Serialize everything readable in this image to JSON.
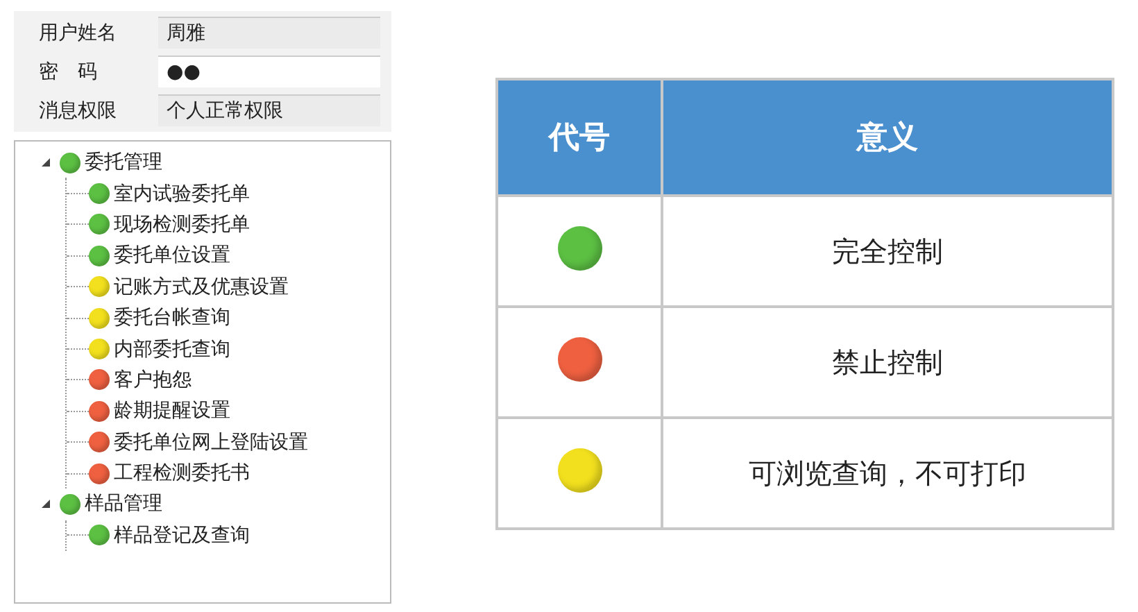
{
  "login_fields": [
    {
      "label": "用户姓名",
      "value": "周雅",
      "readonly": true
    },
    {
      "label": "密　码",
      "value": "●●",
      "readonly": false
    },
    {
      "label": "消息权限",
      "value": "个人正常权限",
      "readonly": true
    }
  ],
  "tree": [
    {
      "label": "委托管理",
      "color": "#5cc043",
      "expanded": true,
      "children": [
        {
          "label": "室内试验委托单",
          "color": "#5cc043"
        },
        {
          "label": "现场检测委托单",
          "color": "#5cc043"
        },
        {
          "label": "委托单位设置",
          "color": "#5cc043"
        },
        {
          "label": "记账方式及优惠设置",
          "color": "#f2e01e"
        },
        {
          "label": "委托台帐查询",
          "color": "#f2e01e"
        },
        {
          "label": "内部委托查询",
          "color": "#f2e01e"
        },
        {
          "label": "客户抱怨",
          "color": "#ee6040"
        },
        {
          "label": "龄期提醒设置",
          "color": "#ee6040"
        },
        {
          "label": "委托单位网上登陆设置",
          "color": "#ee6040"
        },
        {
          "label": "工程检测委托书",
          "color": "#ee6040"
        }
      ]
    },
    {
      "label": "样品管理",
      "color": "#5cc043",
      "expanded": true,
      "children": [
        {
          "label": "样品登记及查询",
          "color": "#5cc043"
        }
      ]
    }
  ],
  "legend_table": {
    "columns": [
      "代号",
      "意义"
    ],
    "rows": [
      {
        "color": "#5cc043",
        "meaning": "完全控制"
      },
      {
        "color": "#ee6040",
        "meaning": "禁止控制"
      },
      {
        "color": "#f2e01e",
        "meaning": "可浏览查询，不可打印"
      }
    ]
  }
}
